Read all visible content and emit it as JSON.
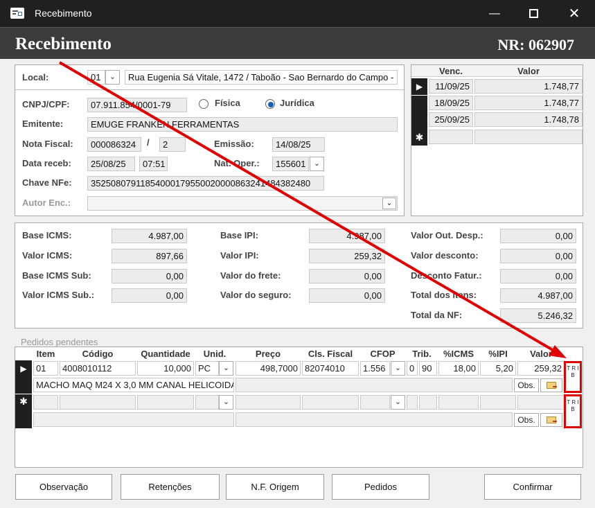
{
  "window": {
    "title": "Recebimento"
  },
  "header": {
    "title": "Recebimento",
    "nr": "NR: 062907"
  },
  "form": {
    "local_label": "Local:",
    "local_code": "01",
    "local_address": "Rua Eugenia Sá Vitale, 1472 / Taboão - Sao Bernardo do Campo -",
    "cnpj_label": "CNPJ/CPF:",
    "cnpj_value": "07.911.854/0001-79",
    "fisica_label": "Física",
    "juridica_label": "Jurídica",
    "emitente_label": "Emitente:",
    "emitente_value": "EMUGE FRANKEN FERRAMENTAS",
    "nf_label": "Nota Fiscal:",
    "nf_value": "000086324",
    "nf_sep": "/",
    "nf_serie": "2",
    "emissao_label": "Emissão:",
    "emissao_value": "14/08/25",
    "data_receb_label": "Data receb:",
    "data_receb_value": "25/08/25",
    "hora_receb_value": "07:51",
    "nat_oper_label": "Nat. Oper.:",
    "nat_oper_value": "155601",
    "chave_label": "Chave NFe:",
    "chave_value": "35250807911854000179550020000863241484382480",
    "autor_label": "Autor Enc.:"
  },
  "venc": {
    "headers": [
      "Venc.",
      "Valor"
    ],
    "rows": [
      {
        "venc": "11/09/25",
        "valor": "1.748,77"
      },
      {
        "venc": "18/09/25",
        "valor": "1.748,77"
      },
      {
        "venc": "25/09/25",
        "valor": "1.748,78"
      }
    ],
    "new_marker": "✱"
  },
  "totals": {
    "base_icms_label": "Base ICMS:",
    "base_icms": "4.987,00",
    "valor_icms_label": "Valor ICMS:",
    "valor_icms": "897,66",
    "base_icms_sub_label": "Base ICMS Sub:",
    "base_icms_sub": "0,00",
    "valor_icms_sub_label": "Valor ICMS Sub.:",
    "valor_icms_sub": "0,00",
    "base_ipi_label": "Base IPI:",
    "base_ipi": "4.987,00",
    "valor_ipi_label": "Valor IPI:",
    "valor_ipi": "259,32",
    "valor_frete_label": "Valor do frete:",
    "valor_frete": "0,00",
    "valor_seguro_label": "Valor do seguro:",
    "valor_seguro": "0,00",
    "out_desp_label": "Valor Out. Desp.:",
    "out_desp": "0,00",
    "desconto_label": "Valor desconto:",
    "desconto": "0,00",
    "desc_fatur_label": "Desconto Fatur.:",
    "desc_fatur": "0,00",
    "total_itens_label": "Total dos itens:",
    "total_itens": "4.987,00",
    "total_nf_label": "Total da NF:",
    "total_nf": "5.246,32"
  },
  "items": {
    "section_label": "Pedidos pendentes",
    "headers": {
      "item": "Item",
      "codigo": "Código",
      "quantidade": "Quantidade",
      "unid": "Unid.",
      "preco": "Preço",
      "cls_fiscal": "Cls. Fiscal",
      "cfop": "CFOP",
      "trib": "Trib.",
      "icms": "%ICMS",
      "ipi": "%IPI",
      "valor": "Valor"
    },
    "row1": {
      "item": "01",
      "codigo": "4008010112",
      "quantidade": "10,000",
      "unid": "PC",
      "preco": "498,7000",
      "cls_fiscal": "82074010",
      "cfop": "1.556",
      "trib1": "0",
      "trib2": "90",
      "icms": "18,00",
      "ipi": "5,20",
      "valor": "259,32",
      "descricao": "MACHO MAQ M24 X 3,0 MM CANAL HELICOIDA"
    },
    "obs_label": "Obs.",
    "trib_label": "T R I B",
    "new_marker": "✱"
  },
  "buttons": {
    "observacao": "Observação",
    "retencoes": "Retenções",
    "nf_origem": "N.F.  Origem",
    "pedidos": "Pedidos",
    "confirmar": "Confirmar"
  },
  "colors": {
    "annotation": "#e00000",
    "accent": "#1a5fb4"
  }
}
